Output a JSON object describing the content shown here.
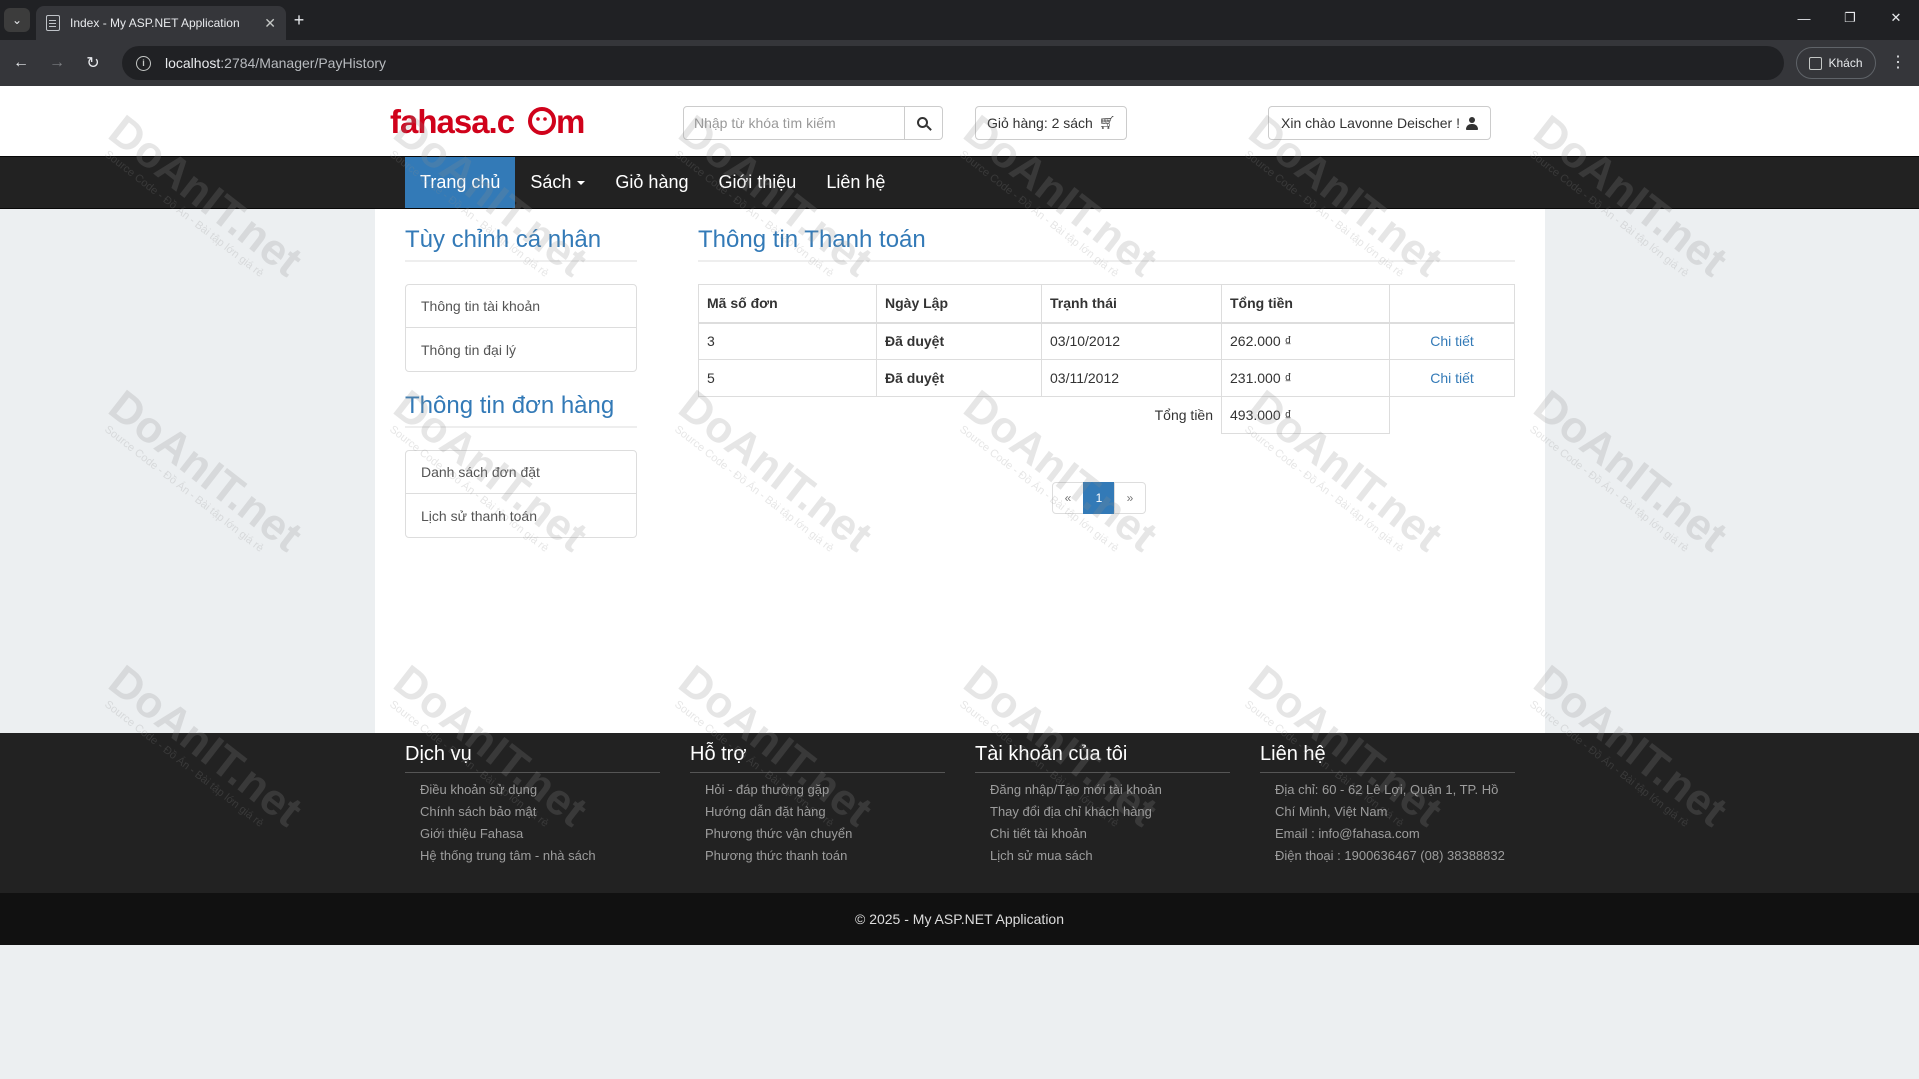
{
  "browser": {
    "tab_title": "Index - My ASP.NET Application",
    "url_host": "localhost",
    "url_path": ":2784/Manager/PayHistory",
    "profile_label": "Khách"
  },
  "header": {
    "logo_text": "fahasa.com",
    "search_placeholder": "Nhập từ khóa tìm kiếm",
    "cart_label": "Giỏ hàng: 2 sách",
    "user_label": "Xin chào Lavonne Deischer !"
  },
  "nav": {
    "items": [
      "Trang chủ",
      "Sách",
      "Giỏ hàng",
      "Giới thiệu",
      "Liên hệ"
    ]
  },
  "sidebar": {
    "section1_title": "Tùy chỉnh cá nhân",
    "section1_items": [
      "Thông tin tài khoản",
      "Thông tin đại lý"
    ],
    "section2_title": "Thông tin đơn hàng",
    "section2_items": [
      "Danh sách đơn đặt",
      "Lịch sử thanh toán"
    ]
  },
  "content": {
    "title": "Thông tin Thanh toán",
    "columns": [
      "Mã số đơn",
      "Ngày Lập",
      "Trạnh thái",
      "Tổng tiền",
      ""
    ],
    "rows": [
      {
        "id": "3",
        "status": "Đã duyệt",
        "date": "03/10/2012",
        "amount": "262.000 ₫",
        "action": "Chi tiết"
      },
      {
        "id": "5",
        "status": "Đã duyệt",
        "date": "03/11/2012",
        "amount": "231.000 ₫",
        "action": "Chi tiết"
      }
    ],
    "total_label": "Tổng tiền",
    "total_value": "493.000 ₫"
  },
  "pagination": {
    "prev": "«",
    "current": "1",
    "next": "»"
  },
  "footer": {
    "cols": [
      {
        "title": "Dịch vụ",
        "links": [
          "Điều khoản sử dụng",
          "Chính sách bảo mật",
          "Giới thiệu Fahasa",
          "Hệ thống trung tâm - nhà sách"
        ]
      },
      {
        "title": "Hỗ trợ",
        "links": [
          "Hỏi - đáp thường gặp",
          "Hướng dẫn đặt hàng",
          "Phương thức vận chuyển",
          "Phương thức thanh toán"
        ]
      },
      {
        "title": "Tài khoản của tôi",
        "links": [
          "Đăng nhập/Tạo mới tài khoản",
          "Thay đổi địa chỉ khách hàng",
          "Chi tiết tài khoản",
          "Lịch sử mua sách"
        ]
      },
      {
        "title": "Liên hệ",
        "links": [
          "Địa chỉ: 60 - 62 Lê Lợi, Quận 1, TP. Hồ Chí Minh, Việt Nam",
          "Email : info@fahasa.com",
          "Điện thoại : 1900636467 (08) 38388832"
        ]
      }
    ],
    "copyright": "© 2025 - My ASP.NET Application"
  },
  "watermark": {
    "text": "DoAnIT.net",
    "sub": "Source Code - Đồ Án - Bài tập lớn giá rẻ"
  }
}
